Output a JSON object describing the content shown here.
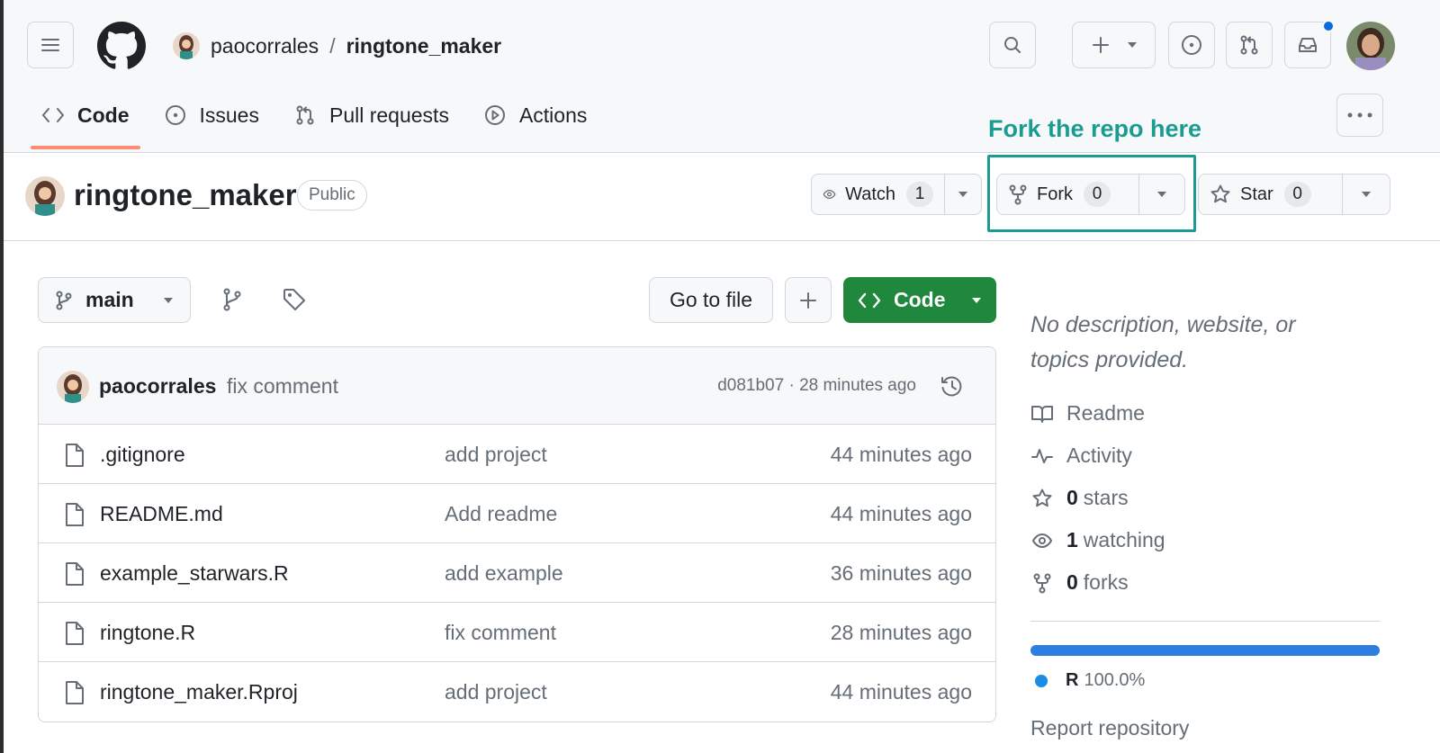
{
  "breadcrumb": {
    "owner": "paocorrales",
    "separator": "/",
    "repo": "ringtone_maker"
  },
  "tabs": [
    {
      "label": "Code",
      "icon": "code-icon",
      "active": true
    },
    {
      "label": "Issues",
      "icon": "issue-opened-icon"
    },
    {
      "label": "Pull requests",
      "icon": "git-pull-request-icon"
    },
    {
      "label": "Actions",
      "icon": "play-icon"
    }
  ],
  "annotation": "Fork the repo here",
  "repo": {
    "name": "ringtone_maker",
    "visibility": "Public"
  },
  "actions": {
    "watch": {
      "label": "Watch",
      "count": "1"
    },
    "fork": {
      "label": "Fork",
      "count": "0"
    },
    "star": {
      "label": "Star",
      "count": "0"
    }
  },
  "toolbar": {
    "branch": "main",
    "go_to_file": "Go to file",
    "code": "Code"
  },
  "commit": {
    "author": "paocorrales",
    "message": "fix comment",
    "meta": "d081b07 · 28 minutes ago"
  },
  "files": [
    {
      "name": ".gitignore",
      "message": "add project",
      "time": "44 minutes ago"
    },
    {
      "name": "README.md",
      "message": "Add readme",
      "time": "44 minutes ago"
    },
    {
      "name": "example_starwars.R",
      "message": "add example",
      "time": "36 minutes ago"
    },
    {
      "name": "ringtone.R",
      "message": "fix comment",
      "time": "28 minutes ago"
    },
    {
      "name": "ringtone_maker.Rproj",
      "message": "add project",
      "time": "44 minutes ago"
    }
  ],
  "sidebar": {
    "description": "No description, website, or topics provided.",
    "readme": "Readme",
    "activity": "Activity",
    "stars_count": "0",
    "stars_label": "stars",
    "watching_count": "1",
    "watching_label": "watching",
    "forks_count": "0",
    "forks_label": "forks",
    "language": {
      "name": "R",
      "percent": "100.0%",
      "color": "#198ce7"
    },
    "report": "Report repository"
  },
  "colors": {
    "accent_green": "#1f883d",
    "annotation": "#1a9c90",
    "tab_underline": "#fd8c73",
    "notification": "#0969da"
  }
}
